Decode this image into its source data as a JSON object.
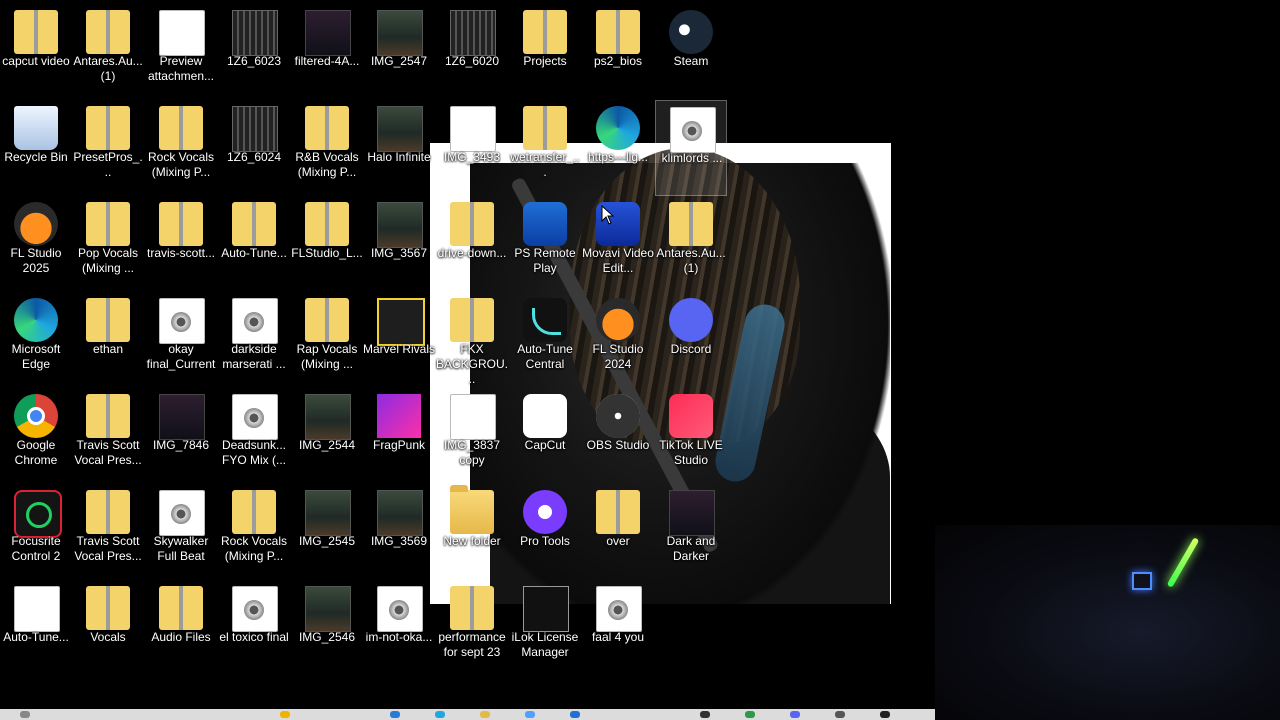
{
  "desktop": {
    "icons": [
      {
        "label": "capcut video"
      },
      {
        "label": "Antares.Au... (1)"
      },
      {
        "label": "Preview attachmen..."
      },
      {
        "label": "1Z6_6023"
      },
      {
        "label": "filtered-4A..."
      },
      {
        "label": "IMG_2547"
      },
      {
        "label": "1Z6_6020"
      },
      {
        "label": "Projects"
      },
      {
        "label": "ps2_bios"
      },
      {
        "label": "Steam"
      },
      {
        "label": "Recycle Bin"
      },
      {
        "label": "PresetPros_..."
      },
      {
        "label": "Rock Vocals (Mixing P..."
      },
      {
        "label": "1Z6_6024"
      },
      {
        "label": "R&B Vocals (Mixing P..."
      },
      {
        "label": "Halo Infinite"
      },
      {
        "label": "IMG_3493"
      },
      {
        "label": "wetransfer_..."
      },
      {
        "label": "https---llg..."
      },
      {
        "label": "klimlords ..."
      },
      {
        "label": "FL Studio 2025"
      },
      {
        "label": "Pop Vocals (Mixing ..."
      },
      {
        "label": "travis-scott..."
      },
      {
        "label": "Auto-Tune..."
      },
      {
        "label": "FLStudio_L..."
      },
      {
        "label": "IMG_3567"
      },
      {
        "label": "drive-down..."
      },
      {
        "label": "PS Remote Play"
      },
      {
        "label": "Movavi Video Edit..."
      },
      {
        "label": "Antares.Au... (1)"
      },
      {
        "label": "Microsoft Edge"
      },
      {
        "label": "ethan"
      },
      {
        "label": "okay final_Current"
      },
      {
        "label": "darkside marserati ..."
      },
      {
        "label": "Rap Vocals (Mixing ..."
      },
      {
        "label": "Marvel Rivals"
      },
      {
        "label": "FKX BACKGROU..."
      },
      {
        "label": "Auto-Tune Central"
      },
      {
        "label": "FL Studio 2024"
      },
      {
        "label": "Discord"
      },
      {
        "label": "Google Chrome"
      },
      {
        "label": "Travis Scott Vocal Pres..."
      },
      {
        "label": "IMG_7846"
      },
      {
        "label": "Deadsunk... FYO Mix (..."
      },
      {
        "label": "IMG_2544"
      },
      {
        "label": "FragPunk"
      },
      {
        "label": "IMG_3837 copy"
      },
      {
        "label": "CapCut"
      },
      {
        "label": "OBS Studio"
      },
      {
        "label": "TikTok LIVE Studio"
      },
      {
        "label": "Focusrite Control 2"
      },
      {
        "label": "Travis Scott Vocal Pres..."
      },
      {
        "label": "Skywalker Full Beat"
      },
      {
        "label": "Rock Vocals (Mixing P..."
      },
      {
        "label": "IMG_2545"
      },
      {
        "label": "IMG_3569"
      },
      {
        "label": "New folder"
      },
      {
        "label": "Pro Tools"
      },
      {
        "label": "over"
      },
      {
        "label": "Dark and Darker"
      },
      {
        "label": "Auto-Tune..."
      },
      {
        "label": "Vocals"
      },
      {
        "label": "Audio Files"
      },
      {
        "label": "el toxico final"
      },
      {
        "label": "IMG_2546"
      },
      {
        "label": "im-not-oka..."
      },
      {
        "label": "performance for sept 23"
      },
      {
        "label": "iLok License Manager"
      },
      {
        "label": "faal 4 you"
      }
    ]
  }
}
